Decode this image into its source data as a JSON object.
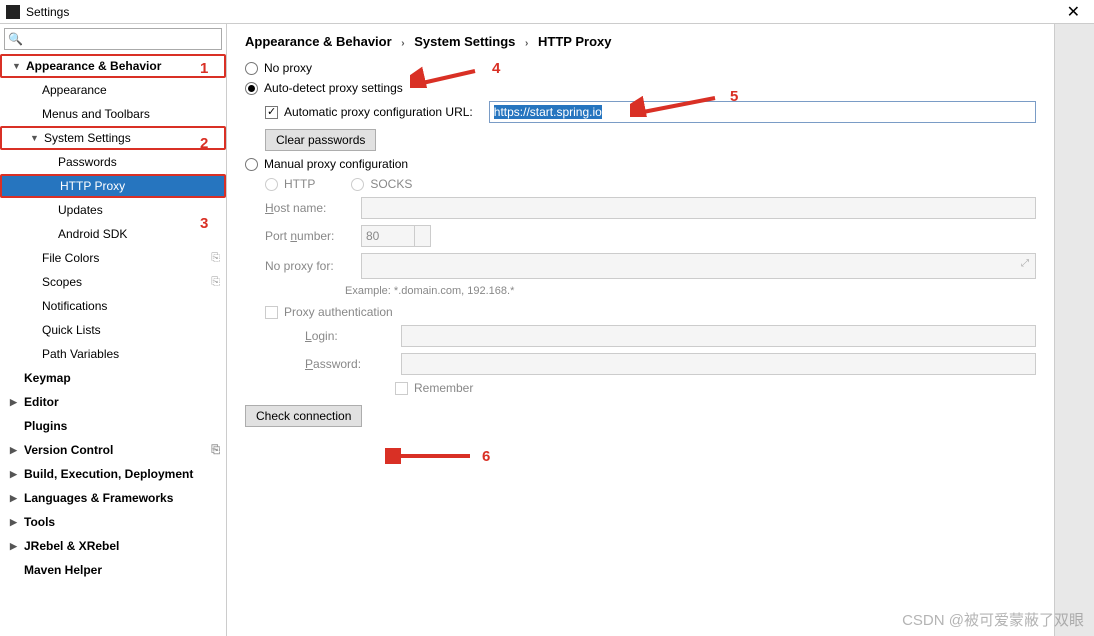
{
  "window": {
    "title": "Settings"
  },
  "search": {
    "placeholder": ""
  },
  "sidebar": {
    "items": [
      {
        "label": "Appearance & Behavior",
        "bold": true,
        "expandable": true,
        "indent": 0,
        "redbox": true
      },
      {
        "label": "Appearance",
        "indent": 1
      },
      {
        "label": "Menus and Toolbars",
        "indent": 1
      },
      {
        "label": "System Settings",
        "expandable": true,
        "indent": 1,
        "redbox": true
      },
      {
        "label": "Passwords",
        "indent": 2
      },
      {
        "label": "HTTP Proxy",
        "indent": 2,
        "selected": true,
        "redbox": true
      },
      {
        "label": "Updates",
        "indent": 2
      },
      {
        "label": "Android SDK",
        "indent": 2
      },
      {
        "label": "File Colors",
        "indent": 1,
        "copy": true
      },
      {
        "label": "Scopes",
        "indent": 1,
        "copy": true
      },
      {
        "label": "Notifications",
        "indent": 1
      },
      {
        "label": "Quick Lists",
        "indent": 1
      },
      {
        "label": "Path Variables",
        "indent": 1
      },
      {
        "label": "Keymap",
        "bold": true,
        "indent": 0
      },
      {
        "label": "Editor",
        "bold": true,
        "expandable": true,
        "collapsed": true,
        "indent": 0
      },
      {
        "label": "Plugins",
        "bold": true,
        "indent": 0
      },
      {
        "label": "Version Control",
        "bold": true,
        "expandable": true,
        "collapsed": true,
        "indent": 0,
        "copy": true
      },
      {
        "label": "Build, Execution, Deployment",
        "bold": true,
        "expandable": true,
        "collapsed": true,
        "indent": 0
      },
      {
        "label": "Languages & Frameworks",
        "bold": true,
        "expandable": true,
        "collapsed": true,
        "indent": 0
      },
      {
        "label": "Tools",
        "bold": true,
        "expandable": true,
        "collapsed": true,
        "indent": 0
      },
      {
        "label": "JRebel & XRebel",
        "bold": true,
        "expandable": true,
        "collapsed": true,
        "indent": 0
      },
      {
        "label": "Maven Helper",
        "bold": true,
        "indent": 0
      }
    ]
  },
  "breadcrumb": {
    "a": "Appearance & Behavior",
    "b": "System Settings",
    "c": "HTTP Proxy"
  },
  "proxy": {
    "no_proxy": "No proxy",
    "auto_detect": "Auto-detect proxy settings",
    "auto_url_label": "Automatic proxy configuration URL:",
    "auto_url_value": "https://start.spring.io",
    "clear_passwords": "Clear passwords",
    "manual": "Manual proxy configuration",
    "http": "HTTP",
    "socks": "SOCKS",
    "host_label": "Host name:",
    "port_label": "Port number:",
    "port_value": "80",
    "noproxy_label": "No proxy for:",
    "example": "Example: *.domain.com, 192.168.*",
    "auth": "Proxy authentication",
    "login": "Login:",
    "password": "Password:",
    "remember": "Remember",
    "check": "Check connection"
  },
  "annotations": {
    "a1": "1",
    "a2": "2",
    "a3": "3",
    "a4": "4",
    "a5": "5",
    "a6": "6"
  },
  "watermark": "CSDN @被可爱蒙蔽了双眼"
}
